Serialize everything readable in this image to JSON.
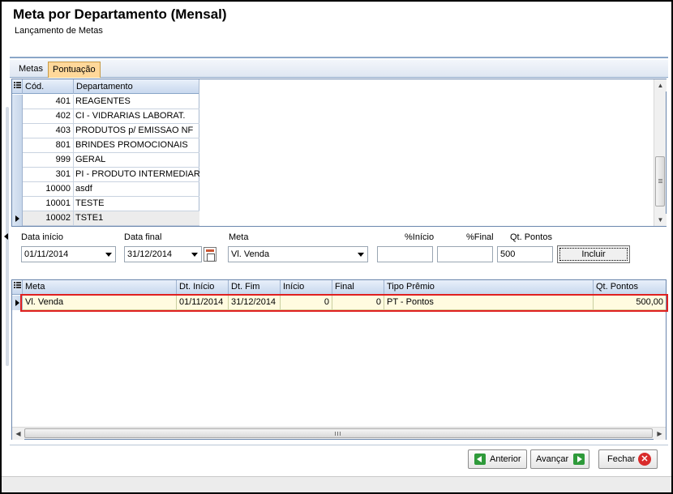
{
  "window": {
    "title": "Meta por Departamento (Mensal)",
    "subtitle": "Lançamento de Metas"
  },
  "tabs": [
    {
      "label": "Metas",
      "active": false
    },
    {
      "label": "Pontuação",
      "active": true
    }
  ],
  "dept_grid": {
    "columns": [
      "Cód.",
      "Departamento"
    ],
    "rows": [
      {
        "code": "401",
        "name": "REAGENTES"
      },
      {
        "code": "402",
        "name": "CI - VIDRARIAS LABORAT."
      },
      {
        "code": "403",
        "name": "PRODUTOS p/ EMISSAO NF"
      },
      {
        "code": "801",
        "name": "BRINDES PROMOCIONAIS"
      },
      {
        "code": "999",
        "name": "GERAL"
      },
      {
        "code": "301",
        "name": "PI - PRODUTO INTERMEDIARI"
      },
      {
        "code": "10000",
        "name": "asdf"
      },
      {
        "code": "10001",
        "name": "TESTE"
      },
      {
        "code": "10002",
        "name": "TSTE1"
      }
    ],
    "selected_row": 8
  },
  "form": {
    "data_inicio_label": "Data início",
    "data_inicio_value": "01/11/2014",
    "data_final_label": "Data final",
    "data_final_value": "31/12/2014",
    "meta_label": "Meta",
    "meta_value": "Vl. Venda",
    "pct_inicio_label": "%Início",
    "pct_inicio_value": "",
    "pct_final_label": "%Final",
    "pct_final_value": "",
    "qt_pontos_label": "Qt. Pontos",
    "qt_pontos_value": "500",
    "incluir_label": "Incluir"
  },
  "goal_grid": {
    "columns": [
      "Meta",
      "Dt. Início",
      "Dt. Fim",
      "Início",
      "Final",
      "Tipo Prêmio",
      "Qt. Pontos"
    ],
    "rows": [
      {
        "meta": "Vl. Venda",
        "dt_inicio": "01/11/2014",
        "dt_fim": "31/12/2014",
        "inicio": "0",
        "final": "0",
        "tipo_premio": "PT - Pontos",
        "qt_pontos": "500,00"
      }
    ]
  },
  "buttons": {
    "anterior": "Anterior",
    "avancar": "Avançar",
    "fechar": "Fechar"
  },
  "colors": {
    "highlight": "#e02020",
    "active_tab": "#ffd89a",
    "icon_green": "#2e9a3a",
    "icon_red": "#d92b2b"
  },
  "icons": {
    "grid_menu": "grid-menu-icon",
    "row_pointer": "row-pointer-icon",
    "calendar": "calendar-icon",
    "back": "arrow-left-icon",
    "forward": "arrow-right-icon",
    "close": "close-icon"
  }
}
